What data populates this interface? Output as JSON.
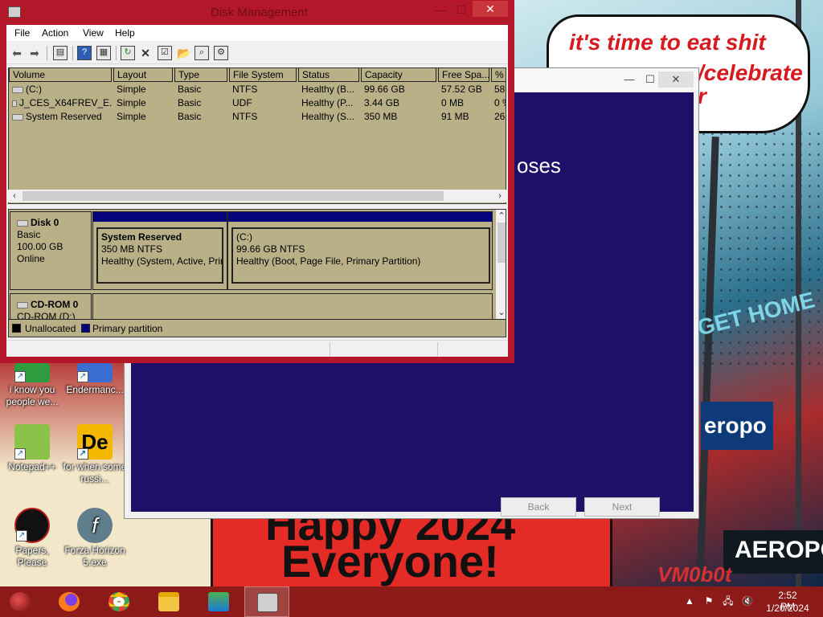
{
  "wallpaper": {
    "speech_line1": "it's time to eat shit",
    "speech_line2": "/celebrate",
    "speech_line3": "r",
    "banner_line1": "Happy 2024",
    "banner_line2": "Everyone!",
    "watermark": "VM0b0t",
    "sign_get_home": "GET HOME",
    "sign_aeropostale": "eropo",
    "sign_aero2": "AEROPOS"
  },
  "desktop_icons": [
    {
      "label": "i know you people we...",
      "icon": "chrome-shortcut-icon",
      "color": "#2e9b3f"
    },
    {
      "label": "Endermanc...",
      "icon": "endermanch-shortcut-icon",
      "color": "#3a6fd1"
    },
    {
      "label": "Notepad++",
      "icon": "notepad-plus-plus-icon",
      "color": "#8bc34a"
    },
    {
      "label": "for when some russi...",
      "icon": "de-shortcut-icon",
      "color": "#f5b800"
    },
    {
      "label": "Papers, Please",
      "icon": "papers-please-icon",
      "color": "#b71c1c"
    },
    {
      "label": "Forza Horizon 5.exe",
      "icon": "flash-player-icon",
      "color": "#607d8b"
    }
  ],
  "setup_window": {
    "heading": "oses",
    "back_label": "Back",
    "next_label": "Next",
    "minimize": "—",
    "maximize": "☐",
    "close": "✕"
  },
  "disk_mgmt": {
    "title": "Disk Management",
    "menu": [
      "File",
      "Action",
      "View",
      "Help"
    ],
    "columns": [
      "Volume",
      "Layout",
      "Type",
      "File System",
      "Status",
      "Capacity",
      "Free Spa...",
      "% F"
    ],
    "rows": [
      [
        "(C:)",
        "Simple",
        "Basic",
        "NTFS",
        "Healthy (B...",
        "99.66 GB",
        "57.52 GB",
        "58"
      ],
      [
        "J_CES_X64FREV_E...",
        "Simple",
        "Basic",
        "UDF",
        "Healthy (P...",
        "3.44 GB",
        "0 MB",
        "0 %"
      ],
      [
        "System Reserved",
        "Simple",
        "Basic",
        "NTFS",
        "Healthy (S...",
        "350 MB",
        "91 MB",
        "26"
      ]
    ],
    "disks": [
      {
        "name": "Disk 0",
        "type": "Basic",
        "size": "100.00 GB",
        "state": "Online"
      },
      {
        "name": "CD-ROM 0",
        "type": "CD-ROM (D:)"
      }
    ],
    "partitions": [
      {
        "name": "System Reserved",
        "size": "350 MB NTFS",
        "status": "Healthy (System, Active, Prin"
      },
      {
        "name": "(C:)",
        "size": "99.66 GB NTFS",
        "status": "Healthy (Boot, Page File, Primary Partition)"
      }
    ],
    "legend": [
      {
        "label": "Unallocated",
        "color": "#000000"
      },
      {
        "label": "Primary partition",
        "color": "#05047e"
      }
    ],
    "close": "✕",
    "minimize": "—",
    "maximize": "☐"
  },
  "taskbar": {
    "time": "2:52 PM",
    "date": "1/20/2024",
    "accent": "#8c1a18",
    "apps": [
      {
        "name": "start-orb",
        "color": "#c62828"
      },
      {
        "name": "firefox",
        "color": "#ff7a18"
      },
      {
        "name": "chrome",
        "color": "#34a853"
      },
      {
        "name": "file-explorer",
        "color": "#f4c542"
      },
      {
        "name": "installer",
        "color": "#4caf50"
      },
      {
        "name": "disk-management",
        "color": "#cfcfcf"
      }
    ]
  }
}
